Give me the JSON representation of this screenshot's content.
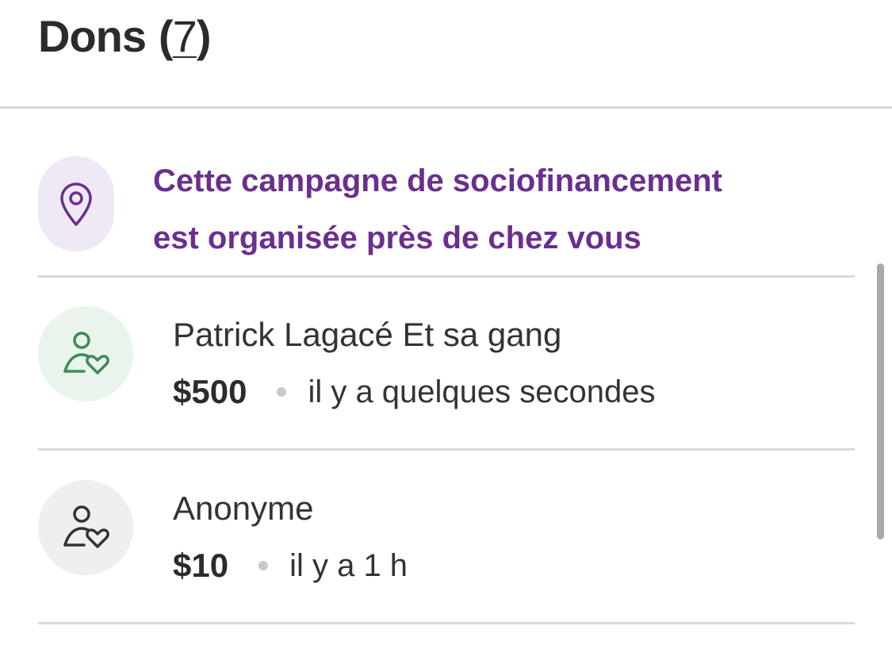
{
  "header": {
    "title": "Dons",
    "open_paren": "(",
    "count": "7",
    "close_paren": ")"
  },
  "location_banner": {
    "icon": "location-pin-icon",
    "text_line1": "Cette campagne de sociofinancement",
    "text_line2": "est organisée près de chez vous",
    "text_color": "#6a2f8e",
    "icon_bg": "#efe9f6"
  },
  "donations": [
    {
      "name": "Patrick Lagacé Et sa gang",
      "amount": "$500",
      "time": "il y a quelques secondes",
      "icon": "donor-heart-icon",
      "icon_color": "#3f8a55",
      "icon_bg": "#e8f4ec"
    },
    {
      "name": "Anonyme",
      "amount": "$10",
      "time": "il y a 1 h",
      "icon": "donor-heart-icon",
      "icon_color": "#333333",
      "icon_bg": "#efefef"
    }
  ]
}
